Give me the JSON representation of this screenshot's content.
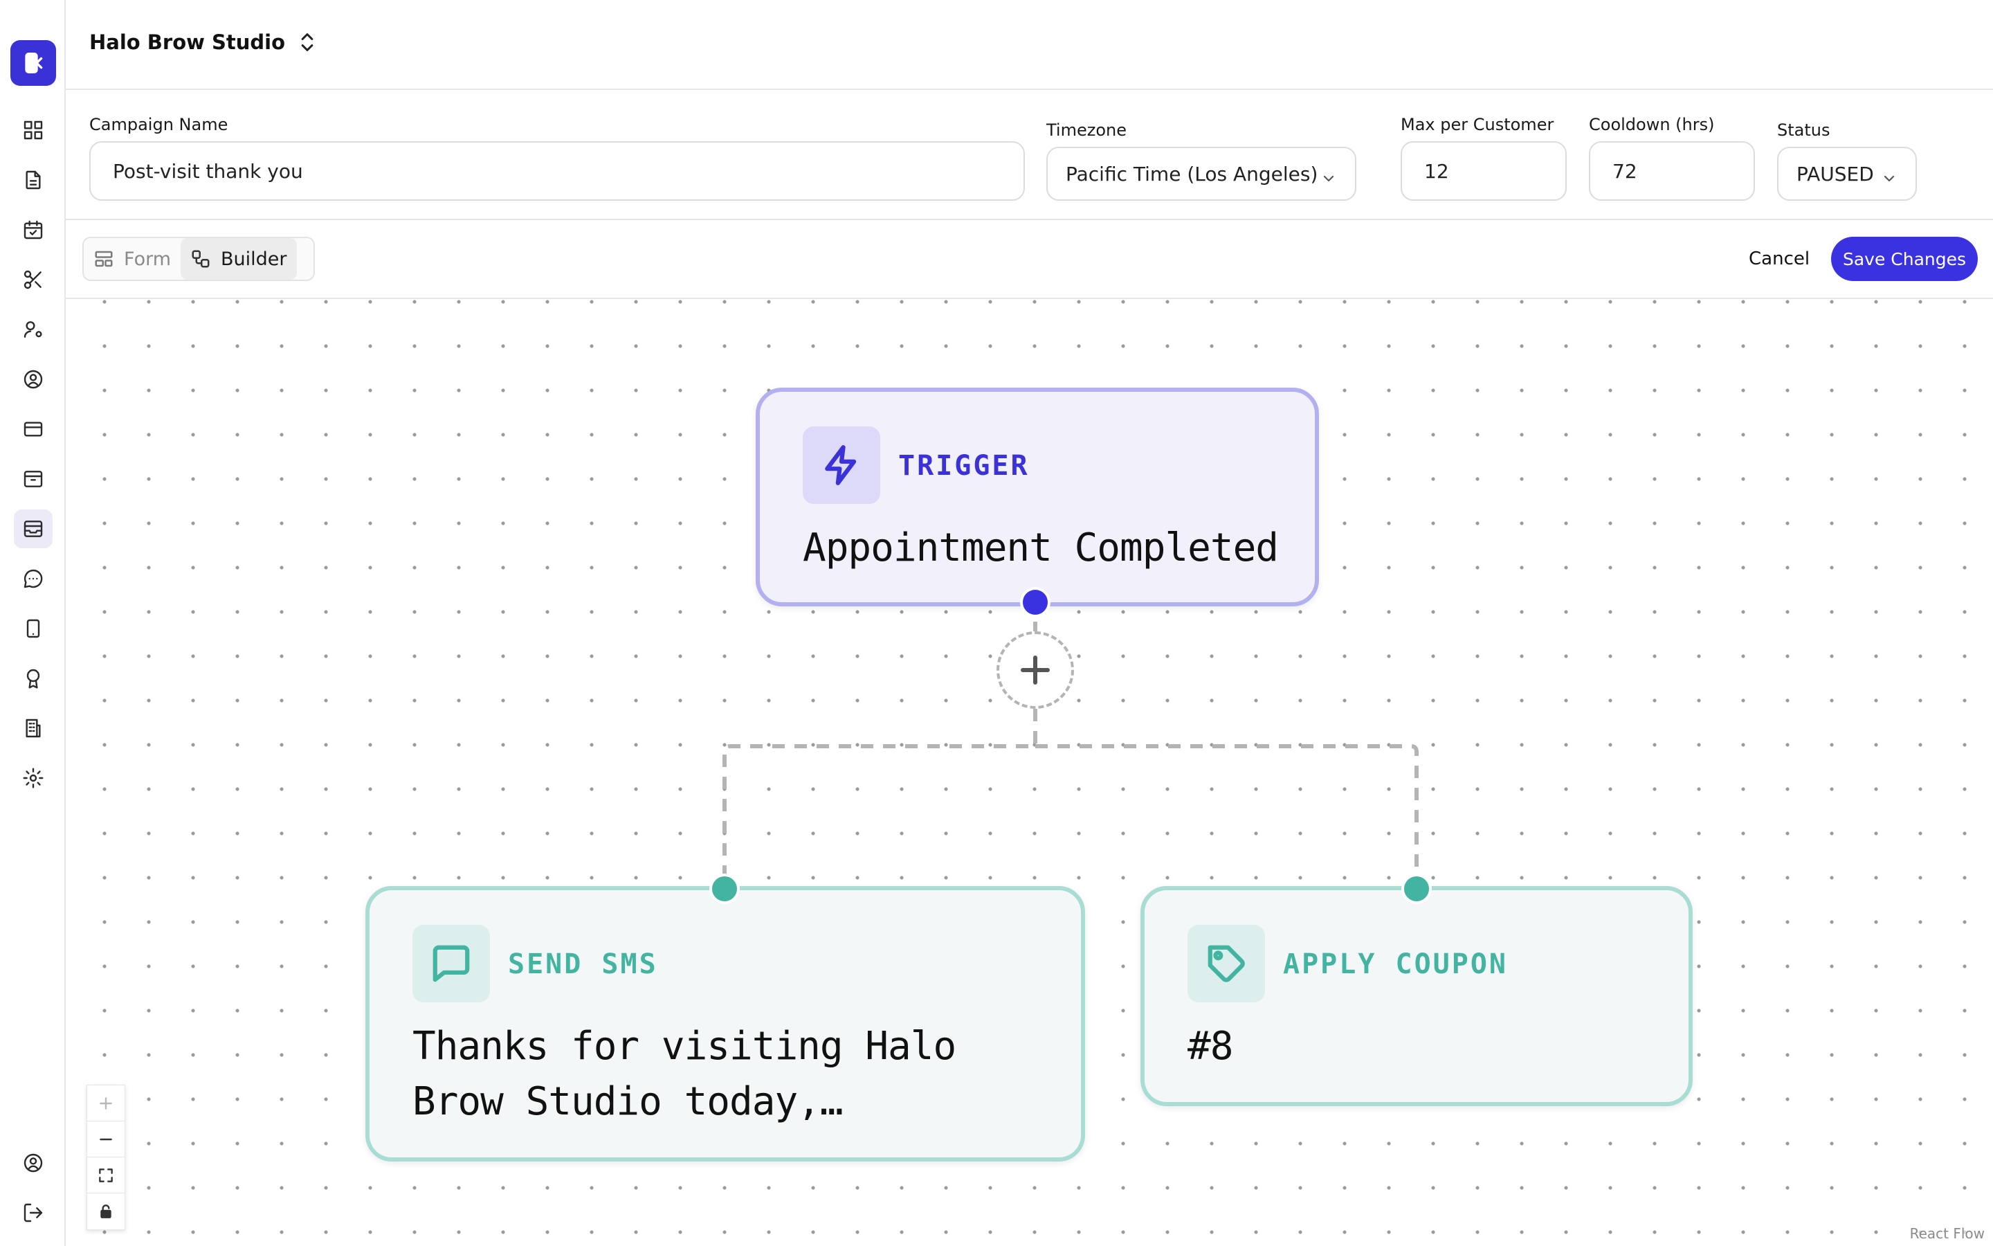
{
  "header": {
    "studio_name": "Halo Brow Studio"
  },
  "form": {
    "campaign_name": {
      "label": "Campaign Name",
      "value": "Post-visit thank you"
    },
    "timezone": {
      "label": "Timezone",
      "value": "Pacific Time (Los Angeles)"
    },
    "max_per_customer": {
      "label": "Max per Customer",
      "value": "12"
    },
    "cooldown": {
      "label": "Cooldown (hrs)",
      "value": "72"
    },
    "status": {
      "label": "Status",
      "value": "PAUSED"
    }
  },
  "toolbar": {
    "view_toggle": {
      "form_label": "Form",
      "builder_label": "Builder",
      "active": "Builder"
    },
    "cancel_label": "Cancel",
    "save_label": "Save Changes"
  },
  "flow": {
    "trigger": {
      "kind": "TRIGGER",
      "text": "Appointment Completed",
      "icon": "lightning-icon"
    },
    "actions": [
      {
        "kind": "SEND SMS",
        "text": "Thanks for visiting Halo Brow Studio today,…",
        "icon": "message-icon"
      },
      {
        "kind": "APPLY COUPON",
        "text": "#8",
        "icon": "tag-icon"
      }
    ]
  },
  "canvas": {
    "attribution": "React Flow"
  },
  "sidebar": {
    "icons": [
      "dashboard-icon",
      "document-icon",
      "calendar-icon",
      "scissors-icon",
      "user-settings-icon",
      "user-circle-icon",
      "credit-card-icon",
      "archive-icon",
      "campaigns-icon",
      "chat-icon",
      "tablet-icon",
      "award-icon",
      "building-icon",
      "settings-icon",
      "account-icon",
      "logout-icon"
    ],
    "active": "campaigns-icon"
  },
  "colors": {
    "primary": "#3a32e0",
    "trigger_border": "#b3b0f0",
    "action_accent": "#43b4a2",
    "action_border": "#a9dcd3"
  }
}
